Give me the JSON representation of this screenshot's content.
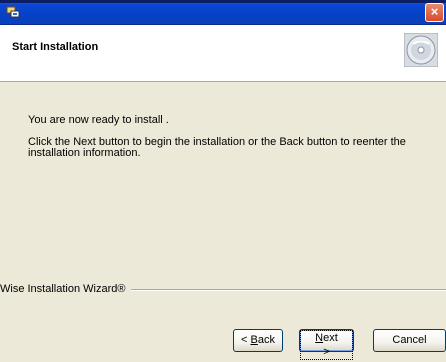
{
  "window": {
    "title": "",
    "close_label": "×"
  },
  "header": {
    "title": "Start Installation",
    "icon": "cd-disc-icon"
  },
  "body": {
    "line1": "You are now ready to install .",
    "line2": "Click the Next button to begin the installation or the Back button to reenter the installation information."
  },
  "footer": {
    "brand": "Wise Installation Wizard®"
  },
  "buttons": {
    "back_prefix": "< ",
    "back_key": "B",
    "back_rest": "ack",
    "next_key": "N",
    "next_rest": "ext >",
    "cancel": "Cancel"
  },
  "colors": {
    "titlebar": "#0542c7",
    "dialog_bg": "#ece9d8",
    "close_button": "#d94a2a"
  }
}
